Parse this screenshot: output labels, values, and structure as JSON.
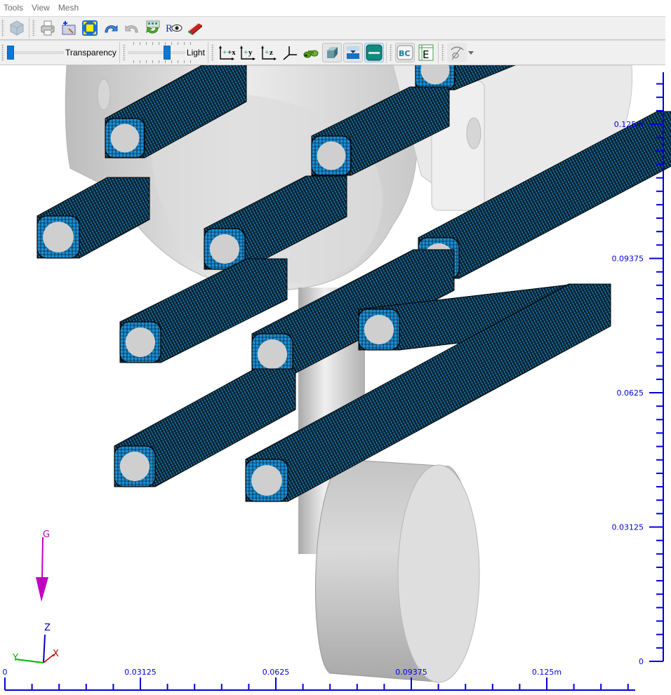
{
  "menu": {
    "items": [
      "Tools",
      "View",
      "Mesh"
    ]
  },
  "toolbar": {
    "row1": [
      {
        "name": "mesh-view-icon",
        "tooltip": "Mesh view"
      },
      {
        "name": "print-icon",
        "tooltip": "Print"
      },
      {
        "name": "add-part-icon",
        "tooltip": "Add"
      },
      {
        "name": "fit-view-icon",
        "tooltip": "Fit to window"
      },
      {
        "name": "undo-icon",
        "tooltip": "Undo"
      },
      {
        "name": "redo-icon",
        "tooltip": "Redo"
      },
      {
        "name": "refresh-icon",
        "tooltip": "Refresh"
      },
      {
        "name": "render-view-icon",
        "tooltip": "Render view",
        "text": "R"
      },
      {
        "name": "material-icon",
        "tooltip": "Material"
      }
    ],
    "transparency": {
      "label": "Transparency",
      "value_fraction": 0.0
    },
    "light": {
      "label": "Light",
      "value_fraction": 0.7
    },
    "view_buttons": [
      {
        "name": "view-plus-x-icon",
        "text": "+x"
      },
      {
        "name": "view-plus-y-icon",
        "text": "+y"
      },
      {
        "name": "view-plus-z-icon",
        "text": "+z"
      },
      {
        "name": "isometric-axes-icon",
        "text": ""
      },
      {
        "name": "binoculars-icon",
        "text": ""
      },
      {
        "name": "solid-shape-icon",
        "text": ""
      },
      {
        "name": "section-plane-icon",
        "text": ""
      },
      {
        "name": "ruler-icon",
        "text": "",
        "active": true
      }
    ],
    "bc_button": {
      "text": "BC"
    },
    "e_button": {
      "text": "E"
    },
    "visibility_dropdown": {
      "name": "hide-eye-icon"
    }
  },
  "viewport": {
    "gravity_label": "G",
    "triad": {
      "x": "X",
      "y": "Y",
      "z": "Z"
    },
    "colors": {
      "axis": "#0000e0",
      "mesh_face": "#1a8fd6",
      "mesh_dark": "#05202e",
      "part": "#d8d8d8",
      "gravity": "#c000c0",
      "triad_x": "#c00000",
      "triad_y": "#00b000",
      "triad_z": "#0000c0"
    },
    "x_ruler": {
      "labels": [
        "0",
        "0.03125",
        "0.0625",
        "0.09375",
        "0.125m"
      ],
      "values": [
        0,
        0.03125,
        0.0625,
        0.09375,
        0.125
      ],
      "minor_per_major": 10,
      "max": 0.15625
    },
    "y_ruler": {
      "labels": [
        "0",
        "0.03125",
        "0.0625",
        "0.09375",
        "0.125m"
      ],
      "values": [
        0,
        0.03125,
        0.0625,
        0.09375,
        0.125
      ],
      "minor_per_major": 10
    }
  }
}
